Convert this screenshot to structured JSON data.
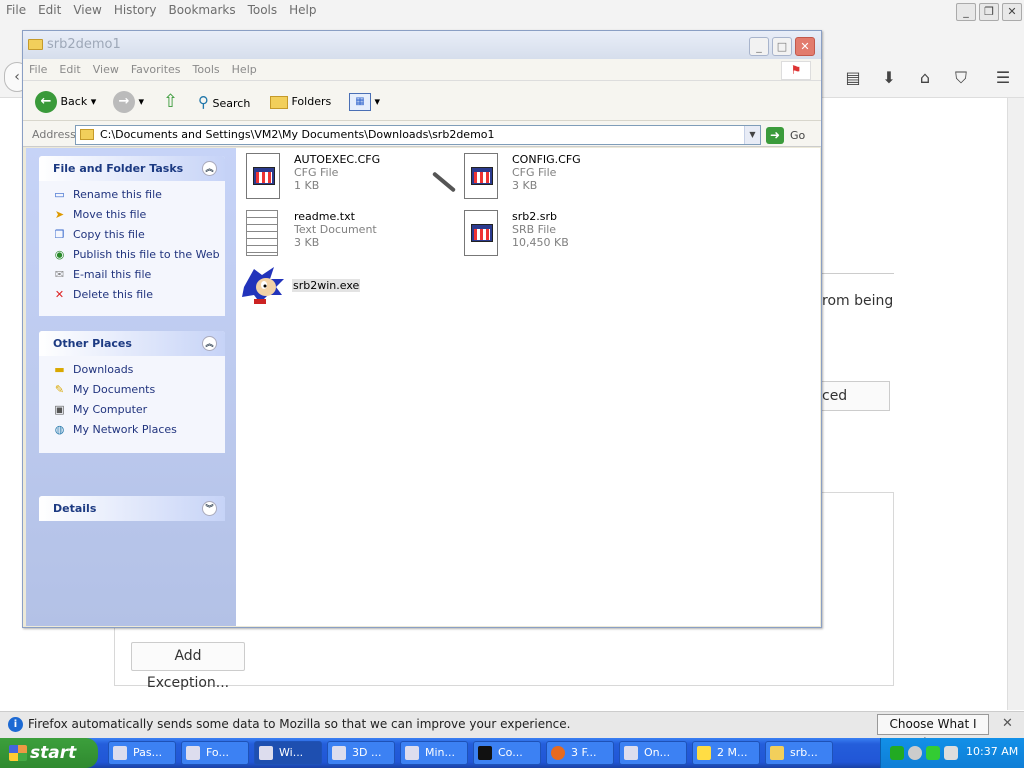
{
  "firefox": {
    "menu": [
      "File",
      "Edit",
      "View",
      "History",
      "Bookmarks",
      "Tools",
      "Help"
    ],
    "text_fragment": "rom being",
    "button_fragment": "ced",
    "add_exception": "Add Exception...",
    "notification": "Firefox automatically sends some data to Mozilla so that we can improve your experience.",
    "notification_button": "Choose What I Share"
  },
  "explorer": {
    "title": "srb2demo1",
    "menu": [
      "File",
      "Edit",
      "View",
      "Favorites",
      "Tools",
      "Help"
    ],
    "toolbar": {
      "back": "Back",
      "search": "Search",
      "folders": "Folders"
    },
    "address_label": "Address",
    "address_value": "C:\\Documents and Settings\\VM2\\My Documents\\Downloads\\srb2demo1",
    "go_label": "Go",
    "panels": {
      "tasks": {
        "title": "File and Folder Tasks",
        "items": [
          "Rename this file",
          "Move this file",
          "Copy this file",
          "Publish this file to the Web",
          "E-mail this file",
          "Delete this file"
        ]
      },
      "places": {
        "title": "Other Places",
        "items": [
          "Downloads",
          "My Documents",
          "My Computer",
          "My Network Places"
        ]
      },
      "details": {
        "title": "Details"
      }
    },
    "files": [
      {
        "name": "AUTOEXEC.CFG",
        "type": "CFG File",
        "size": "1 KB"
      },
      {
        "name": "CONFIG.CFG",
        "type": "CFG File",
        "size": "3 KB"
      },
      {
        "name": "readme.txt",
        "type": "Text Document",
        "size": "3 KB"
      },
      {
        "name": "srb2.srb",
        "type": "SRB File",
        "size": "10,450 KB"
      },
      {
        "name": "srb2win.exe"
      }
    ]
  },
  "taskbar": {
    "start": "start",
    "items": [
      "Pas...",
      "Fo...",
      "Wi...",
      "3D ...",
      "Min...",
      "Co...",
      "3 F...",
      "On...",
      "2 M...",
      "srb..."
    ],
    "clock": "10:37 AM"
  }
}
